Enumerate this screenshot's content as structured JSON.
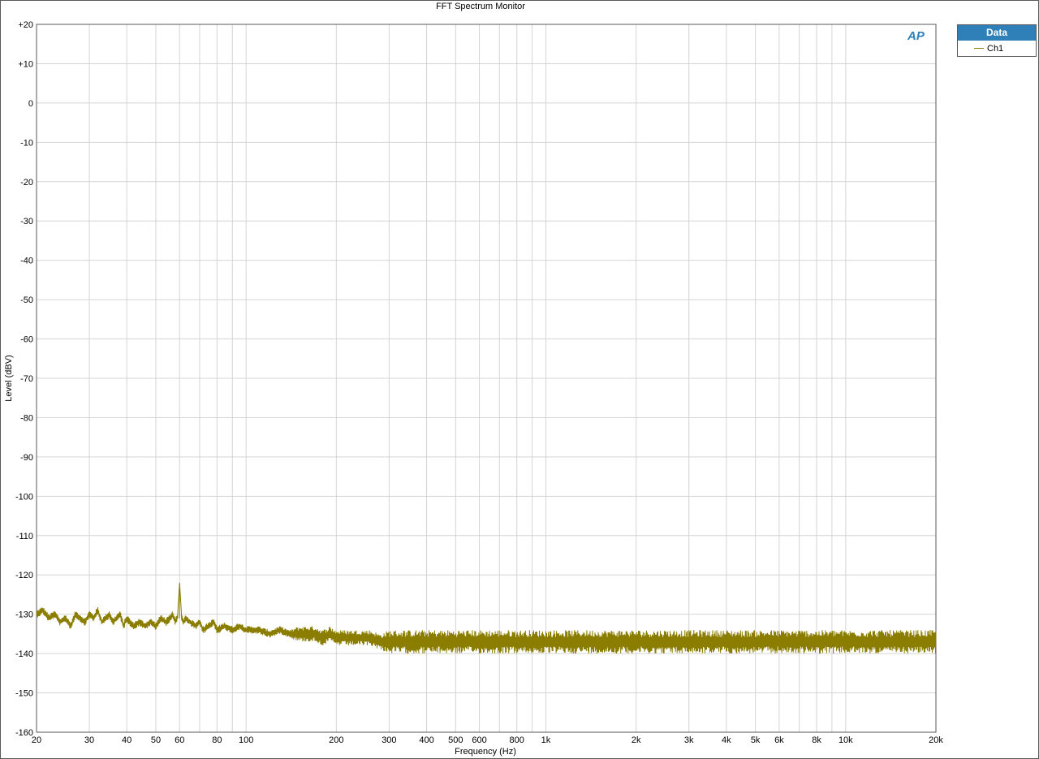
{
  "chart_data": {
    "type": "line",
    "title": "FFT Spectrum Monitor",
    "xlabel": "Frequency (Hz)",
    "ylabel": "Level (dBV)",
    "xscale": "log",
    "xlim": [
      20,
      20000
    ],
    "ylim": [
      -160,
      20
    ],
    "grid": true,
    "legend": {
      "title": "Data",
      "placement": "top-right-outside"
    },
    "x_ticks": [
      {
        "value": 20,
        "label": "20"
      },
      {
        "value": 30,
        "label": "30"
      },
      {
        "value": 40,
        "label": "40"
      },
      {
        "value": 50,
        "label": "50"
      },
      {
        "value": 60,
        "label": "60"
      },
      {
        "value": 80,
        "label": "80"
      },
      {
        "value": 100,
        "label": "100"
      },
      {
        "value": 200,
        "label": "200"
      },
      {
        "value": 300,
        "label": "300"
      },
      {
        "value": 400,
        "label": "400"
      },
      {
        "value": 500,
        "label": "500"
      },
      {
        "value": 600,
        "label": "600"
      },
      {
        "value": 800,
        "label": "800"
      },
      {
        "value": 1000,
        "label": "1k"
      },
      {
        "value": 2000,
        "label": "2k"
      },
      {
        "value": 3000,
        "label": "3k"
      },
      {
        "value": 4000,
        "label": "4k"
      },
      {
        "value": 5000,
        "label": "5k"
      },
      {
        "value": 6000,
        "label": "6k"
      },
      {
        "value": 8000,
        "label": "8k"
      },
      {
        "value": 10000,
        "label": "10k"
      },
      {
        "value": 20000,
        "label": "20k"
      }
    ],
    "y_ticks": [
      {
        "value": 20,
        "label": "+20"
      },
      {
        "value": 10,
        "label": "+10"
      },
      {
        "value": 0,
        "label": "0"
      },
      {
        "value": -10,
        "label": "-10"
      },
      {
        "value": -20,
        "label": "-20"
      },
      {
        "value": -30,
        "label": "-30"
      },
      {
        "value": -40,
        "label": "-40"
      },
      {
        "value": -50,
        "label": "-50"
      },
      {
        "value": -60,
        "label": "-60"
      },
      {
        "value": -70,
        "label": "-70"
      },
      {
        "value": -80,
        "label": "-80"
      },
      {
        "value": -90,
        "label": "-90"
      },
      {
        "value": -100,
        "label": "-100"
      },
      {
        "value": -110,
        "label": "-110"
      },
      {
        "value": -120,
        "label": "-120"
      },
      {
        "value": -130,
        "label": "-130"
      },
      {
        "value": -140,
        "label": "-140"
      },
      {
        "value": -150,
        "label": "-150"
      },
      {
        "value": -160,
        "label": "-160"
      }
    ],
    "series": [
      {
        "name": "Ch1",
        "color": "#8a7d00",
        "x": [
          20,
          21,
          22,
          23,
          24,
          25,
          26,
          27,
          28,
          29,
          30,
          31,
          32,
          33,
          34,
          35,
          36,
          37,
          38,
          39,
          40,
          42,
          44,
          46,
          48,
          50,
          52,
          54,
          56,
          57,
          58,
          59,
          60,
          61,
          62,
          63,
          65,
          68,
          70,
          72,
          75,
          78,
          80,
          85,
          90,
          95,
          100,
          110,
          120,
          130,
          140,
          150,
          160,
          170,
          180,
          190,
          200,
          220,
          240,
          260,
          280,
          300,
          320,
          350,
          380,
          400,
          450,
          500,
          550,
          600,
          650,
          700,
          800,
          900,
          1000,
          1100,
          1200,
          1400,
          1600,
          1800,
          2000,
          2300,
          2600,
          3000,
          3500,
          4000,
          4500,
          5000,
          5500,
          6000,
          7000,
          8000,
          9000,
          10000,
          11000,
          12000,
          13000,
          14000,
          15000,
          16000,
          17000,
          18000,
          19000,
          20000
        ],
        "y": [
          -130,
          -129,
          -131,
          -130,
          -132,
          -131,
          -133,
          -130,
          -131,
          -132,
          -130,
          -131,
          -129,
          -132,
          -131,
          -130,
          -132,
          -131,
          -130,
          -133,
          -131,
          -133,
          -132,
          -133,
          -132,
          -133,
          -131,
          -132,
          -131,
          -130,
          -132,
          -131,
          -122,
          -131,
          -132,
          -131,
          -132,
          -133,
          -132,
          -134,
          -133,
          -132,
          -134,
          -133,
          -134,
          -133,
          -134,
          -134,
          -135,
          -134,
          -135,
          -135,
          -135,
          -135,
          -136,
          -135,
          -136,
          -136,
          -136,
          -136,
          -137,
          -137,
          -137,
          -137,
          -137,
          -137,
          -137,
          -137,
          -137,
          -137,
          -137,
          -137,
          -137,
          -137,
          -137,
          -137,
          -137,
          -137,
          -137,
          -137,
          -137,
          -137,
          -137,
          -137,
          -137,
          -137,
          -137,
          -137,
          -137,
          -137,
          -137,
          -137,
          -137,
          -137,
          -137,
          -137,
          -137,
          -137,
          -137,
          -137,
          -137,
          -137,
          -137,
          -137
        ],
        "noise_ripple_db": [
          1,
          1,
          1,
          1,
          1,
          1,
          1,
          1,
          1,
          1,
          1,
          1,
          1,
          1,
          1,
          1,
          1,
          1,
          1,
          1,
          1,
          1,
          1,
          1,
          1,
          1,
          1,
          1,
          1,
          1,
          1,
          1,
          0,
          1,
          1,
          1,
          1,
          1,
          1,
          1,
          1,
          1,
          1,
          1,
          1,
          1,
          1,
          1,
          1,
          1,
          1,
          2,
          2,
          2,
          2,
          2,
          2,
          2,
          2,
          2,
          2,
          3,
          3,
          3,
          3,
          3,
          3,
          3,
          3,
          3,
          3,
          3,
          3,
          3,
          3,
          3,
          3,
          3,
          3,
          3,
          3,
          3,
          3,
          3,
          3,
          3,
          3,
          3,
          3,
          3,
          3,
          3,
          3,
          3,
          3,
          3,
          3,
          3,
          3,
          3,
          3,
          3,
          3,
          3
        ]
      }
    ]
  },
  "logo": {
    "text": "AP"
  }
}
